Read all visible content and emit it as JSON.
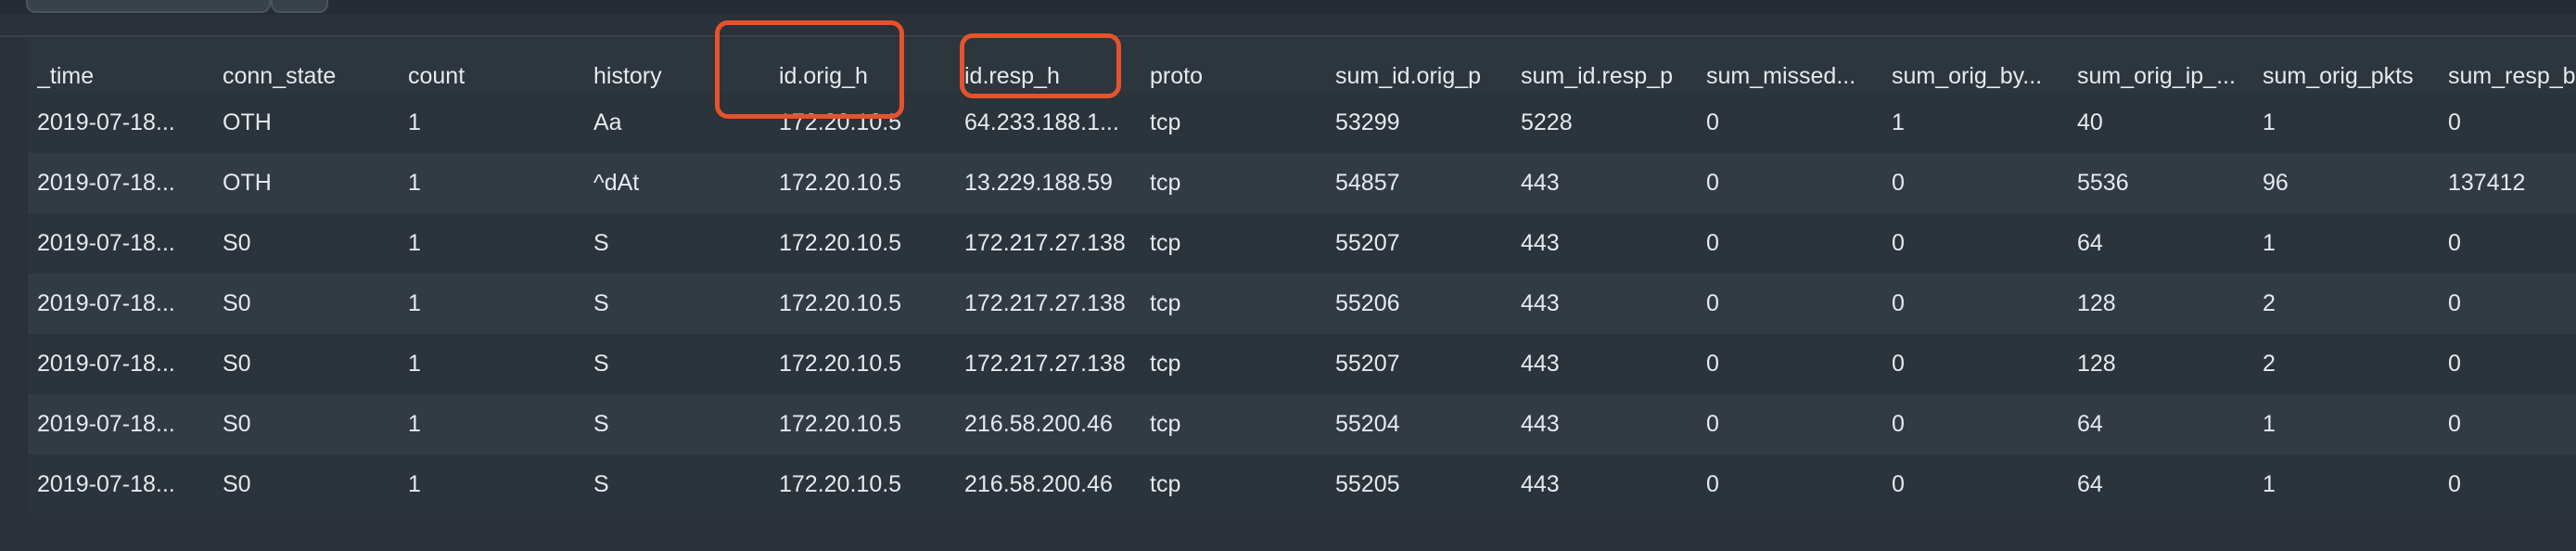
{
  "table": {
    "columns": [
      "_time",
      "conn_state",
      "count",
      "history",
      "id.orig_h",
      "id.resp_h",
      "proto",
      "sum_id.orig_p",
      "sum_id.resp_p",
      "sum_missed...",
      "sum_orig_by...",
      "sum_orig_ip_...",
      "sum_orig_pkts",
      "sum_resp_b"
    ],
    "rows": [
      [
        "2019-07-18...",
        "OTH",
        "1",
        "Aa",
        "172.20.10.5",
        "64.233.188.1...",
        "tcp",
        "53299",
        "5228",
        "0",
        "1",
        "40",
        "1",
        "0"
      ],
      [
        "2019-07-18...",
        "OTH",
        "1",
        "^dAt",
        "172.20.10.5",
        "13.229.188.59",
        "tcp",
        "54857",
        "443",
        "0",
        "0",
        "5536",
        "96",
        "137412"
      ],
      [
        "2019-07-18...",
        "S0",
        "1",
        "S",
        "172.20.10.5",
        "172.217.27.138",
        "tcp",
        "55207",
        "443",
        "0",
        "0",
        "64",
        "1",
        "0"
      ],
      [
        "2019-07-18...",
        "S0",
        "1",
        "S",
        "172.20.10.5",
        "172.217.27.138",
        "tcp",
        "55206",
        "443",
        "0",
        "0",
        "128",
        "2",
        "0"
      ],
      [
        "2019-07-18...",
        "S0",
        "1",
        "S",
        "172.20.10.5",
        "172.217.27.138",
        "tcp",
        "55207",
        "443",
        "0",
        "0",
        "128",
        "2",
        "0"
      ],
      [
        "2019-07-18...",
        "S0",
        "1",
        "S",
        "172.20.10.5",
        "216.58.200.46",
        "tcp",
        "55204",
        "443",
        "0",
        "0",
        "64",
        "1",
        "0"
      ],
      [
        "2019-07-18...",
        "S0",
        "1",
        "S",
        "172.20.10.5",
        "216.58.200.46",
        "tcp",
        "55205",
        "443",
        "0",
        "0",
        "64",
        "1",
        "0"
      ]
    ]
  },
  "highlight_color": "#e5532d"
}
